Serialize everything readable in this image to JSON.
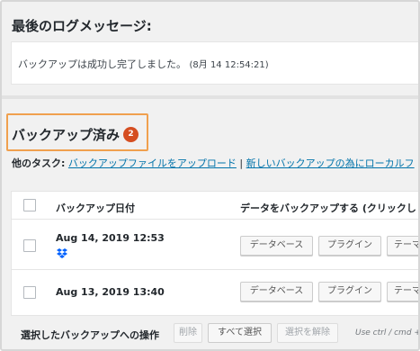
{
  "log": {
    "heading": "最後のログメッセージ:",
    "message": "バックアップは成功し完了しました。",
    "time": "(8月 14 12:54:21)"
  },
  "section": {
    "title": "バックアップ済み",
    "count": "2"
  },
  "tasks": {
    "label": "他のタスク:",
    "upload_link": "バックアップファイルをアップロード",
    "separator": "|",
    "local_link": "新しいバックアップの為にローカルフ"
  },
  "table": {
    "headers": {
      "date": "バックアップ日付",
      "backup_data": "データをバックアップする (クリックし"
    },
    "rows": [
      {
        "date": "Aug 14, 2019 12:53",
        "has_dropbox": true,
        "buttons": [
          "データベース",
          "プラグイン",
          "テーマ"
        ]
      },
      {
        "date": "Aug 13, 2019 13:40",
        "has_dropbox": false,
        "buttons": [
          "データベース",
          "プラグイン",
          "テーマ"
        ]
      }
    ]
  },
  "bulk": {
    "label": "選択したバックアップへの操作",
    "delete": "削除",
    "select_all": "すべて選択",
    "deselect": "選択を解除",
    "hint": "Use ctrl / cmd + p"
  },
  "colors": {
    "accent_border": "#f0a04e",
    "badge": "#d54e21",
    "link": "#0073aa",
    "dropbox": "#0061fe"
  },
  "icons": {
    "dropbox": "dropbox-icon"
  }
}
